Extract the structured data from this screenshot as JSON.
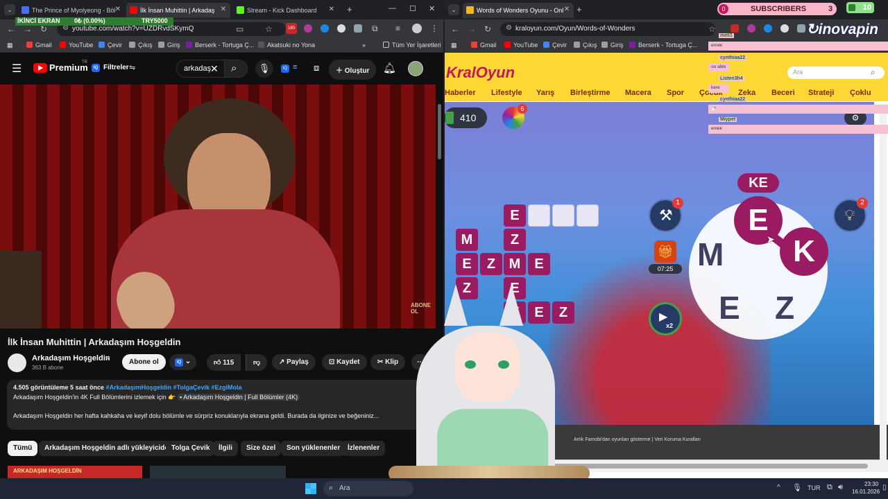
{
  "left": {
    "tabs": [
      {
        "title": "The Prince of Myolyeong - Böl",
        "icon_color": "#4a6cf7"
      },
      {
        "title": "İlk İnsan Muhittin | Arkadaş",
        "icon_color": "#ff0000"
      },
      {
        "title": "Stream - Kick Dashboard",
        "icon_color": "#53fc18"
      }
    ],
    "overlay_banner": {
      "label": "İKİNCİ EKRAN",
      "value": "0₺ (0.00%)",
      "goal": "TRY5000"
    },
    "url": "youtube.com/watch?v=UZDRvdSKymQ",
    "bookmarks": [
      "Gmail",
      "YouTube",
      "Çevir",
      "Çıkış",
      "Giriş",
      "Berserk - Tortuga Ç...",
      "Akatsuki no Yona"
    ],
    "all_bookmarks": "Tüm Yer İşaretleri",
    "youtube": {
      "logo": "Premium",
      "logo_region": "TR",
      "filters": "Filtreler",
      "search_value": "arkadaş",
      "create": "Oluştur",
      "video_watermark": "ABONE OL",
      "video_title": "İlk İnsan Muhittin | Arkadaşım Hoşgeldin",
      "channel": "Arkadaşım Hoşgeldin",
      "subs": "363 B abone",
      "subscribe": "Abone ol",
      "likes": "115",
      "share": "Paylaş",
      "save": "Kaydet",
      "clip": "Klip",
      "desc_stats": "4.505 görüntüleme  5 saat önce",
      "desc_tags": "#ArkadaşımHoşgeldin #TolgaÇevik #EzgiMola",
      "desc_line1": "Arkadaşım Hoşgeldin'in 4K Full Bölümlerini izlemek için 👉",
      "desc_link": "▪ Arkadaşım Hoşgeldin | Full Bölümler (4K)",
      "desc_line2": "Arkadaşım Hoşgeldin her hafta kahkaha ve keyif dolu bölümle ve sürpriz konuklarıyla ekrana geldi. Burada da ilginize ve beğeniniz...",
      "chips": [
        "Tümü",
        "Arkadaşım Hoşgeldin adlı yükleyiciden",
        "Tolga Çevik",
        "İlgili",
        "Size özel",
        "Son yüklenenler",
        "İzlenenler"
      ],
      "thumb_text": "ARKADAŞIM HOŞGELDİN"
    }
  },
  "right": {
    "tab": {
      "title": "Words of Wonders Oyunu - Onl",
      "icon_color": "#f2b824"
    },
    "url": "kraloyun.com/Oyun/Words-of-Wonders",
    "bookmarks": [
      "Gmail",
      "YouTube",
      "Çevir",
      "Çıkış",
      "Giriş",
      "Berserk - Tortuga Ç..."
    ],
    "site": {
      "logo": "KralOyun",
      "search_placeholder": "Ara",
      "categories": [
        "Haberler",
        "Lifestyle",
        "Yarış",
        "Birleştirme",
        "Macera",
        "Spor",
        "Çocuk",
        "Zeka",
        "Beceri",
        "Strateji",
        "Çoklu"
      ],
      "footer": "Artık Famobi'dan oyunları gösterme | Veri Koruma Kuralları"
    },
    "game": {
      "coins": "410",
      "wheel_badge": "6",
      "hammer_badge": "1",
      "hint_badge": "2",
      "gift_timer": "07:25",
      "video_mult": "x2",
      "current_word": "KE",
      "wheel_letters": [
        "E",
        "M",
        "K",
        "E",
        "Z"
      ],
      "grid": [
        {
          "letter": "E",
          "state": "filled"
        },
        {
          "letter": "",
          "state": "empty"
        },
        {
          "letter": "",
          "state": "empty"
        },
        {
          "letter": "",
          "state": "empty"
        },
        {
          "letter": "M",
          "state": "filled"
        },
        {
          "letter": "Z",
          "state": "filled"
        },
        {
          "letter": "E",
          "state": "filled"
        },
        {
          "letter": "Z",
          "state": "filled"
        },
        {
          "letter": "M",
          "state": "filled"
        },
        {
          "letter": "E",
          "state": "filled"
        },
        {
          "letter": "Z",
          "state": "filled"
        },
        {
          "letter": "E",
          "state": "filled"
        },
        {
          "letter": "K",
          "state": "filled"
        },
        {
          "letter": "E",
          "state": "filled"
        },
        {
          "letter": "Z",
          "state": "filled"
        }
      ]
    }
  },
  "stream_overlay": {
    "subscribers_label": "SUBSCRIBERS",
    "subscribers_count": "0",
    "subscribers_goal": "3",
    "top_right_count": "10",
    "brand": "inovapin",
    "chat": [
      {
        "user": "meli1",
        "msg": "ernek"
      },
      {
        "user": "cynthiaa22",
        "msg": "oo ablo"
      },
      {
        "user": "Listen3h4",
        "msg": "kere"
      },
      {
        "user": "cynthiaa22",
        "msg": "🍼"
      },
      {
        "user": "Miypet",
        "msg": "emek"
      }
    ]
  },
  "taskbar": {
    "search": "Ara",
    "lang": "TUR",
    "time": "23:30",
    "date": "16.01.2026"
  }
}
